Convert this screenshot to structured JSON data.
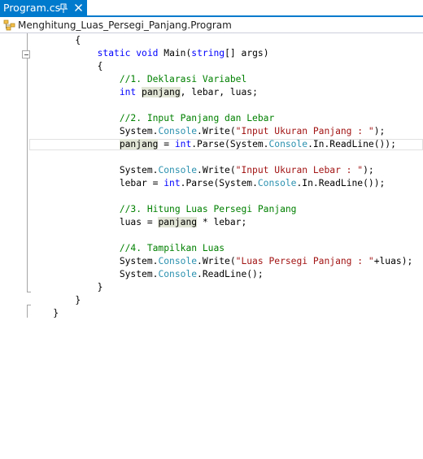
{
  "tab": {
    "title": "Program.cs",
    "pin_icon": "pin-icon",
    "close_icon": "close-icon",
    "accent": "#007acc"
  },
  "navbar": {
    "icon": "class-icon",
    "label": "Menghitung_Luas_Persegi_Panjang.Program"
  },
  "colors": {
    "keyword": "#0000ff",
    "type": "#2b91af",
    "string": "#a31515",
    "comment": "#008000",
    "highlight": "#e2e6d6"
  },
  "code": {
    "l1": {
      "brace": "{"
    },
    "l2": {
      "static": "static",
      "void": "void",
      "main": "Main(",
      "string": "string",
      "args": "[] args)"
    },
    "l3": {
      "brace": "{"
    },
    "l4": {
      "comment": "//1. Deklarasi Variabel"
    },
    "l5": {
      "int": "int",
      "sp": " ",
      "panjang": "panjang",
      "rest": ", lebar, luas;"
    },
    "l7": {
      "comment": "//2. Input Panjang dan Lebar"
    },
    "l8": {
      "system": "System.",
      "console": "Console",
      "write": ".Write(",
      "str": "\"Input Ukuran Panjang : \"",
      "end": ");"
    },
    "l9": {
      "panjang": "panjang",
      "eq": " = ",
      "int": "int",
      "parse": ".Parse(System.",
      "console": "Console",
      "end": ".In.ReadLine());"
    },
    "l11": {
      "system": "System.",
      "console": "Console",
      "write": ".Write(",
      "str": "\"Input Ukuran Lebar : \"",
      "end": ");"
    },
    "l12": {
      "lebar": "lebar = ",
      "int": "int",
      "parse": ".Parse(System.",
      "console": "Console",
      "end": ".In.ReadLine());"
    },
    "l14": {
      "comment": "//3. Hitung Luas Persegi Panjang"
    },
    "l15": {
      "luas": "luas = ",
      "panjang": "panjang",
      "rest": " * lebar;"
    },
    "l17": {
      "comment": "//4. Tampilkan Luas"
    },
    "l18": {
      "system": "System.",
      "console": "Console",
      "write": ".Write(",
      "str": "\"Luas Persegi Panjang : \"",
      "end": "+luas);"
    },
    "l19": {
      "system": "System.",
      "console": "Console",
      "end": ".ReadLine();"
    },
    "l20": {
      "brace": "}"
    },
    "l21": {
      "brace": "}"
    },
    "l22": {
      "brace": "}"
    }
  }
}
